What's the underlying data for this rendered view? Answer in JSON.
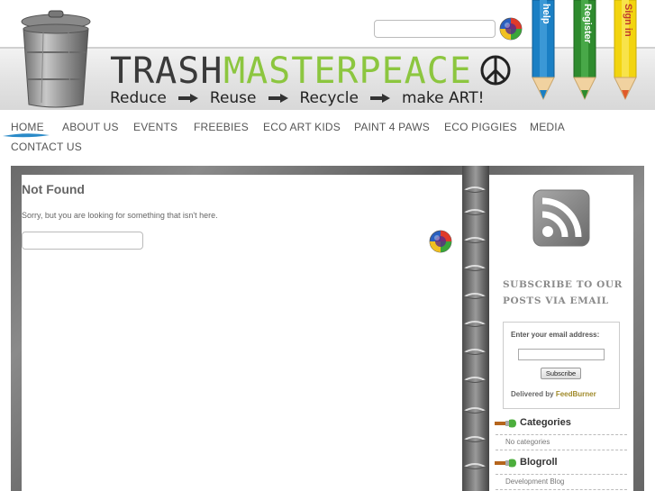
{
  "header": {
    "title_part1": "TRASH",
    "title_part2": "MASTERPEACE",
    "tagline": [
      "Reduce",
      "Reuse",
      "Recycle",
      "make ART!"
    ],
    "search_placeholder": "",
    "pencils": [
      {
        "label": "help",
        "color": "#1a7fc4"
      },
      {
        "label": "Register",
        "color": "#2e8b2e"
      },
      {
        "label": "Sign in",
        "color": "#f2d40f"
      }
    ]
  },
  "nav": {
    "items": [
      "HOME",
      "ABOUT US",
      "EVENTS",
      "FREEBIES",
      "ECO ART KIDS",
      "PAINT 4 PAWS",
      "ECO PIGGIES",
      "MEDIA",
      "CONTACT US"
    ],
    "active": "HOME"
  },
  "main": {
    "title": "Not Found",
    "message": "Sorry, but you are looking for something that isn't here.",
    "search_placeholder": ""
  },
  "sidebar": {
    "subscribe_heading": "SUBSCRIBE TO OUR POSTS VIA EMAIL",
    "email_label": "Enter your email address:",
    "subscribe_button": "Subscribe",
    "delivered_by": "Delivered by",
    "feedburner": "FeedBurner",
    "categories_heading": "Categories",
    "categories_empty": "No categories",
    "blogroll_heading": "Blogroll",
    "blogroll_items": [
      "Development Blog"
    ]
  },
  "colors": {
    "accent_green": "#8cc63f",
    "nav_swoosh": "#2a8ac8",
    "board_grey": "#777777"
  }
}
